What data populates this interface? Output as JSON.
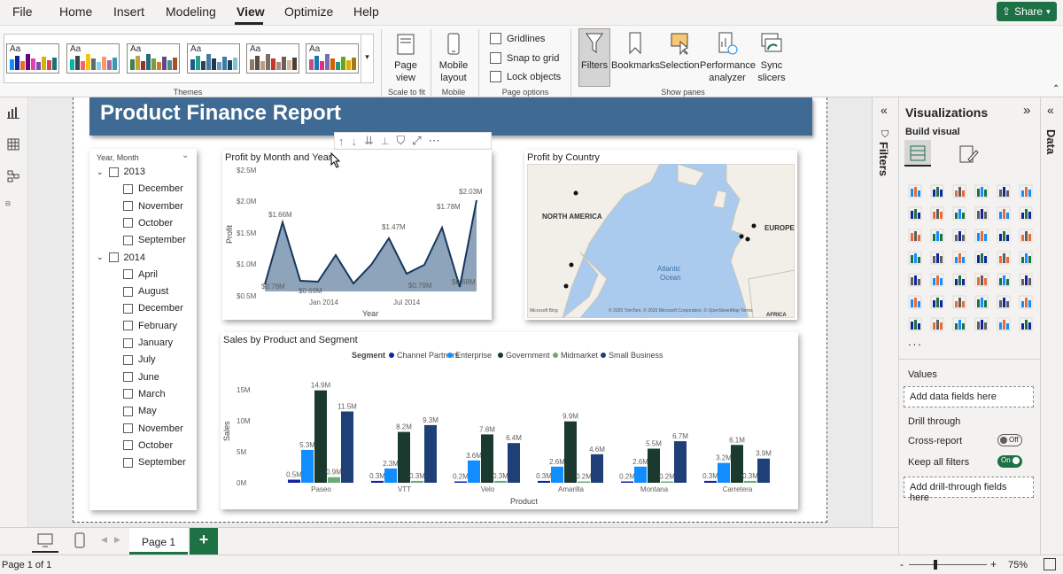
{
  "menu": {
    "items": [
      "File",
      "Home",
      "Insert",
      "Modeling",
      "View",
      "Optimize",
      "Help"
    ],
    "active": "View",
    "share_label": "Share"
  },
  "ribbon": {
    "themes_label": "Themes",
    "theme_aa": "Aa",
    "page_view_label": "Page view",
    "scale_to_fit_label": "Scale to fit",
    "mobile_layout_label": "Mobile layout",
    "mobile_label": "Mobile",
    "gridlines_label": "Gridlines",
    "snap_label": "Snap to grid",
    "lock_label": "Lock objects",
    "page_options_label": "Page options",
    "filters_label": "Filters",
    "bookmarks_label": "Bookmarks",
    "selection_label": "Selection",
    "performance_label": "Performance analyzer",
    "sync_label": "Sync slicers",
    "show_panes_label": "Show panes"
  },
  "report": {
    "title": "Product Finance Report"
  },
  "slicer": {
    "header": "Year, Month",
    "years": [
      {
        "label": "2013",
        "months": [
          "December",
          "November",
          "October",
          "September"
        ]
      },
      {
        "label": "2014",
        "months": [
          "April",
          "August",
          "December",
          "February",
          "January",
          "July",
          "June",
          "March",
          "May",
          "November",
          "October",
          "September"
        ]
      }
    ]
  },
  "line_chart": {
    "title": "Profit by Month and Year",
    "xlabel": "Year",
    "ylabel": "Profit",
    "yticks": [
      "$2.5M",
      "$2.0M",
      "$1.5M",
      "$1.0M",
      "$0.5M"
    ],
    "xticks": [
      "Jan 2014",
      "Jul 2014"
    ],
    "data_labels": [
      "$0.78M",
      "$1.66M",
      "$0.69M",
      "$1.47M",
      "$0.79M",
      "$1.78M",
      "$0.68M",
      "$2.03M"
    ]
  },
  "map": {
    "title": "Profit by Country",
    "labels": [
      "NORTH AMERICA",
      "EUROPE",
      "Atlantic Ocean",
      "AFRICA"
    ],
    "attribution": "© 2025 TomTom, © 2025 Microsoft Corporation, © OpenStreetMap  Terms",
    "bing": "Microsoft Bing"
  },
  "bar_chart_card": {
    "title": "Sales by Product and Segment",
    "legend_title": "Segment"
  },
  "chart_data": {
    "type": "bar",
    "title": "Sales by Product and Segment",
    "xlabel": "Product",
    "ylabel": "Sales",
    "categories": [
      "Paseo",
      "VTT",
      "Velo",
      "Amarilla",
      "Montana",
      "Carretera"
    ],
    "yticks": [
      "15M",
      "10M",
      "5M",
      "0M"
    ],
    "ylim": [
      0,
      16
    ],
    "unit": "M",
    "legend_position": "top",
    "series": [
      {
        "name": "Channel Partners",
        "color": "#12239e",
        "values": [
          0.5,
          0.3,
          0.2,
          0.3,
          0.2,
          0.3
        ],
        "labels": [
          "0.5M",
          "0.3M",
          "0.2M",
          "0.3M",
          "0.2M",
          "0.3M"
        ]
      },
      {
        "name": "Enterprise",
        "color": "#118dff",
        "values": [
          5.3,
          2.3,
          3.6,
          2.6,
          2.6,
          3.2
        ],
        "labels": [
          "5.3M",
          "2.3M",
          "3.6M",
          "2.6M",
          "2.6M",
          "3.2M"
        ]
      },
      {
        "name": "Government",
        "color": "#1b3a2f",
        "values": [
          14.9,
          8.2,
          7.8,
          9.9,
          5.5,
          6.1
        ],
        "labels": [
          "14.9M",
          "8.2M",
          "7.8M",
          "9.9M",
          "5.5M",
          "6.1M"
        ]
      },
      {
        "name": "Midmarket",
        "color": "#6aab7a",
        "values": [
          0.9,
          0.3,
          0.3,
          0.2,
          0.2,
          0.3
        ],
        "labels": [
          "0.9M",
          "0.3M",
          "0.3M",
          "0.2M",
          "0.2M",
          "0.3M"
        ]
      },
      {
        "name": "Small Business",
        "color": "#1f3f77",
        "values": [
          11.5,
          9.3,
          6.4,
          4.6,
          6.7,
          3.9
        ],
        "labels": [
          "11.5M",
          "9.3M",
          "6.4M",
          "4.6M",
          "6.7M",
          "3.9M"
        ]
      }
    ]
  },
  "filters_pane": {
    "label": "Filters"
  },
  "viz_pane": {
    "title": "Visualizations",
    "build_visual": "Build visual",
    "more": "...",
    "values_label": "Values",
    "values_placeholder": "Add data fields here",
    "drill_label": "Drill through",
    "cross_report_label": "Cross-report",
    "cross_report_state": "Off",
    "keep_filters_label": "Keep all filters",
    "keep_filters_state": "On",
    "drill_placeholder": "Add drill-through fields here"
  },
  "data_pane": {
    "label": "Data"
  },
  "pages": {
    "tab_label": "Page 1",
    "add_label": "+"
  },
  "status": {
    "page_info": "Page 1 of 1",
    "zoom": "75%",
    "minus": "-",
    "plus": "+"
  }
}
